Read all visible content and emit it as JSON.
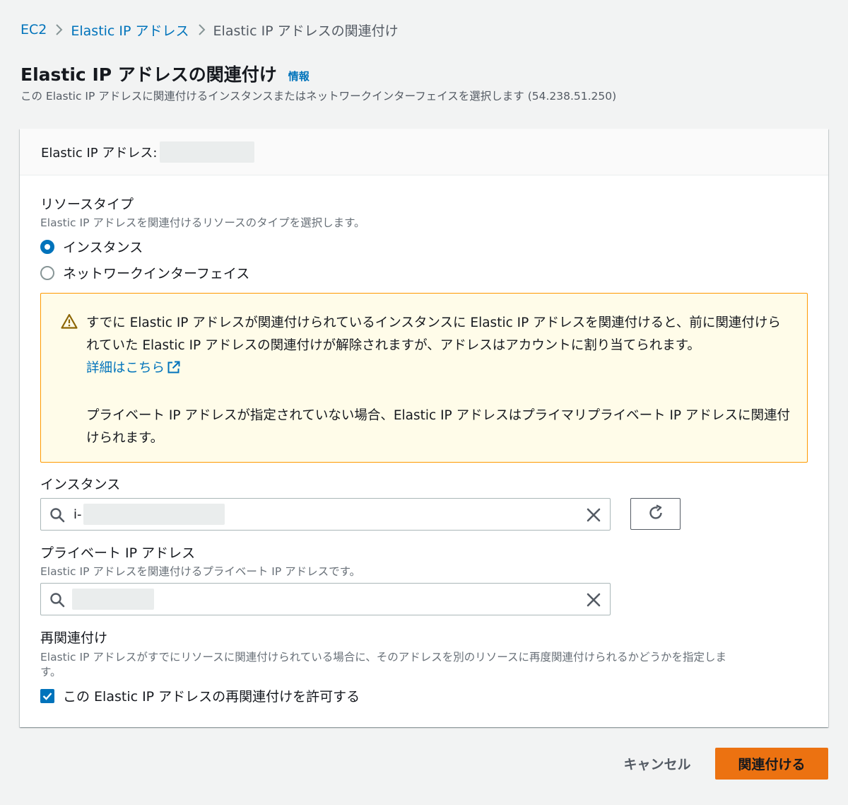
{
  "breadcrumb": {
    "items": [
      "EC2",
      "Elastic IP アドレス",
      "Elastic IP アドレスの関連付け"
    ]
  },
  "header": {
    "title": "Elastic IP アドレスの関連付け",
    "info_link": "情報",
    "description": "この Elastic IP アドレスに関連付けるインスタンスまたはネットワークインターフェイスを選択します (54.238.51.250)"
  },
  "container": {
    "header_label": "Elastic IP アドレス:"
  },
  "resource_type": {
    "label": "リソースタイプ",
    "description": "Elastic IP アドレスを関連付けるリソースのタイプを選択します。",
    "options": [
      "インスタンス",
      "ネットワークインターフェイス"
    ],
    "selected": "インスタンス"
  },
  "alert": {
    "text1": "すでに Elastic IP アドレスが関連付けられているインスタンスに Elastic IP アドレスを関連付けると、前に関連付けられていた Elastic IP アドレスの関連付けが解除されますが、アドレスはアカウントに割り当てられます。",
    "link": "詳細はこちら",
    "text2": "プライベート IP アドレスが指定されていない場合、Elastic IP アドレスはプライマリプライベート IP アドレスに関連付けられます。"
  },
  "instance": {
    "label": "インスタンス",
    "value_prefix": "i-"
  },
  "private_ip": {
    "label": "プライベート IP アドレス",
    "description": "Elastic IP アドレスを関連付けるプライベート IP アドレスです。"
  },
  "reassociation": {
    "label": "再関連付け",
    "description_line1": "Elastic IP アドレスがすでにリソースに関連付けられている場合に、そのアドレスを別のリソースに再度関連付けられるかどうかを指定しま",
    "description_line2": "す。",
    "checkbox_label": "この Elastic IP アドレスの再関連付けを許可する",
    "checked": true
  },
  "footer": {
    "cancel": "キャンセル",
    "submit": "関連付ける"
  },
  "colors": {
    "link": "#0073bb",
    "primary_button": "#ec7211",
    "alert_bg": "#fffce9",
    "alert_border": "#ff9900"
  }
}
